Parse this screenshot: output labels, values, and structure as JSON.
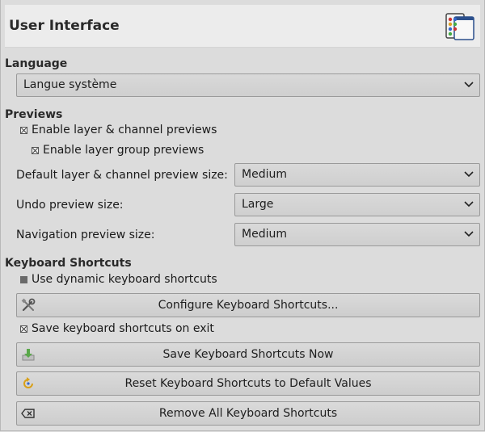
{
  "header": {
    "title": "User Interface",
    "icon": "interface-prefs-icon"
  },
  "language": {
    "section": "Language",
    "value": "Langue système"
  },
  "previews": {
    "section": "Previews",
    "enable_layer_previews": {
      "label": "Enable layer & channel previews",
      "checked": true
    },
    "enable_group_previews": {
      "label": "Enable layer group previews",
      "checked": true
    },
    "default_size": {
      "label": "Default layer & channel preview size:",
      "value": "Medium"
    },
    "undo_size": {
      "label": "Undo preview size:",
      "value": "Large"
    },
    "nav_size": {
      "label": "Navigation preview size:",
      "value": "Medium"
    }
  },
  "shortcuts": {
    "section": "Keyboard Shortcuts",
    "dynamic": {
      "label": "Use dynamic keyboard shortcuts",
      "checked": false
    },
    "configure": "Configure Keyboard Shortcuts...",
    "save_on_exit": {
      "label": "Save keyboard shortcuts on exit",
      "checked": true
    },
    "save_now": "Save Keyboard Shortcuts Now",
    "reset": "Reset Keyboard Shortcuts to Default Values",
    "remove_all": "Remove All Keyboard Shortcuts"
  }
}
